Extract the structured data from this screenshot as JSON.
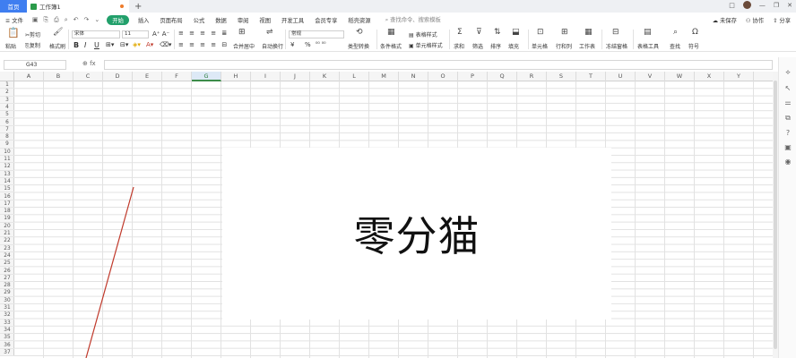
{
  "titlebar": {
    "home_tab": "首页",
    "doc_tab": "工作簿1",
    "add_tab": "+",
    "controls": [
      "□",
      "—",
      "❐",
      "✕"
    ]
  },
  "menubar": {
    "file": "≡ 文件",
    "start": "开始",
    "items": [
      "插入",
      "页面布局",
      "公式",
      "数据",
      "审阅",
      "视图",
      "开发工具",
      "会员专享",
      "稻壳资源"
    ],
    "search": "查找命令、搜索模板",
    "unsaved": "未保存",
    "collab": "协作",
    "share": "分享"
  },
  "ribbon": {
    "paste": "粘贴",
    "cut": "剪切",
    "copy": "复制",
    "format_painter": "格式刷",
    "font_name": "宋体",
    "font_size": "11",
    "bold": "B",
    "italic": "I",
    "underline": "U",
    "merge": "合并居中",
    "wrap": "自动换行",
    "number_format": "常规",
    "currency": "¥",
    "percent": "%",
    "type_convert": "类型转换",
    "cond_format": "条件格式",
    "table_style": "表格样式",
    "cell_style": "单元格样式",
    "sum": "求和",
    "filter": "筛选",
    "sort": "排序",
    "fill": "填充",
    "cell": "单元格",
    "row_col": "行和列",
    "worksheet": "工作表",
    "freeze": "冻结窗格",
    "table_tools": "表格工具",
    "find": "查找",
    "symbol": "符号"
  },
  "formulabar": {
    "cell_ref": "G43",
    "fx": "fx"
  },
  "grid": {
    "columns": [
      "A",
      "B",
      "C",
      "D",
      "E",
      "F",
      "G",
      "H",
      "I",
      "J",
      "K",
      "L",
      "M",
      "N",
      "O",
      "P",
      "Q",
      "R",
      "S",
      "T",
      "U",
      "V",
      "W",
      "X",
      "Y"
    ],
    "selected_column": "G",
    "rows": [
      "1",
      "2",
      "3",
      "4",
      "5",
      "6",
      "7",
      "8",
      "9",
      "10",
      "11",
      "12",
      "13",
      "14",
      "15",
      "16",
      "17",
      "18",
      "19",
      "20",
      "21",
      "22",
      "23",
      "24",
      "25",
      "26",
      "27",
      "28",
      "29",
      "30",
      "31",
      "32",
      "33",
      "34",
      "35",
      "36",
      "37"
    ]
  },
  "overlay": {
    "text": "零分猫"
  },
  "colors": {
    "accent_blue": "#3f7ef0",
    "start_green": "#22a06b",
    "line_red": "#c0392b"
  }
}
